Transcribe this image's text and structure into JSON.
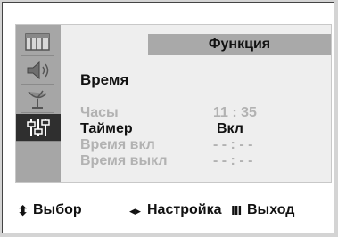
{
  "menu": {
    "header": "Функция",
    "section_title": "Время",
    "rows": [
      {
        "label": "Часы",
        "value": "11 : 35"
      },
      {
        "label": "Таймер",
        "value": "Вкл"
      },
      {
        "label": "Время вкл",
        "value": "- - : - -"
      },
      {
        "label": "Время выкл",
        "value": "- - : - -"
      }
    ]
  },
  "sidebar": {
    "icons": [
      "picture-icon",
      "sound-icon",
      "channel-antenna-icon",
      "function-settings-icon"
    ]
  },
  "footer": {
    "select_glyph": "⬍",
    "select_label": "Выбор",
    "adjust_glyph": "◂▸",
    "adjust_label": "Настройка",
    "exit_glyph": "Ⅲ",
    "exit_label": "Выход"
  },
  "colors": {
    "active_text": "#111111",
    "dim_text": "#b2b2b2",
    "header_bg": "#a9a9a9",
    "selected_icon_bg": "#2f2f2f"
  }
}
